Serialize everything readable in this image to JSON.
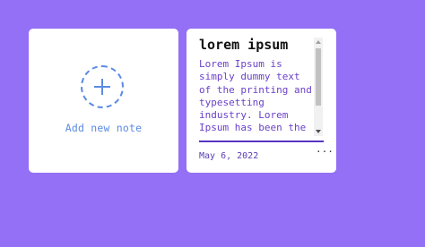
{
  "add_note": {
    "label": "Add new note",
    "icon": "plus-icon"
  },
  "note": {
    "title": "lorem ipsum",
    "body": "Lorem Ipsum is simply dummy text of the printing and typesetting industry. Lorem Ipsum has been the",
    "date": "May 6, 2022",
    "menu_glyph": "···"
  },
  "colors": {
    "background": "#9370f5",
    "card": "#ffffff",
    "accent_blue": "#5b8be3",
    "body_text": "#6a40c9",
    "divider": "#5a34c4"
  }
}
